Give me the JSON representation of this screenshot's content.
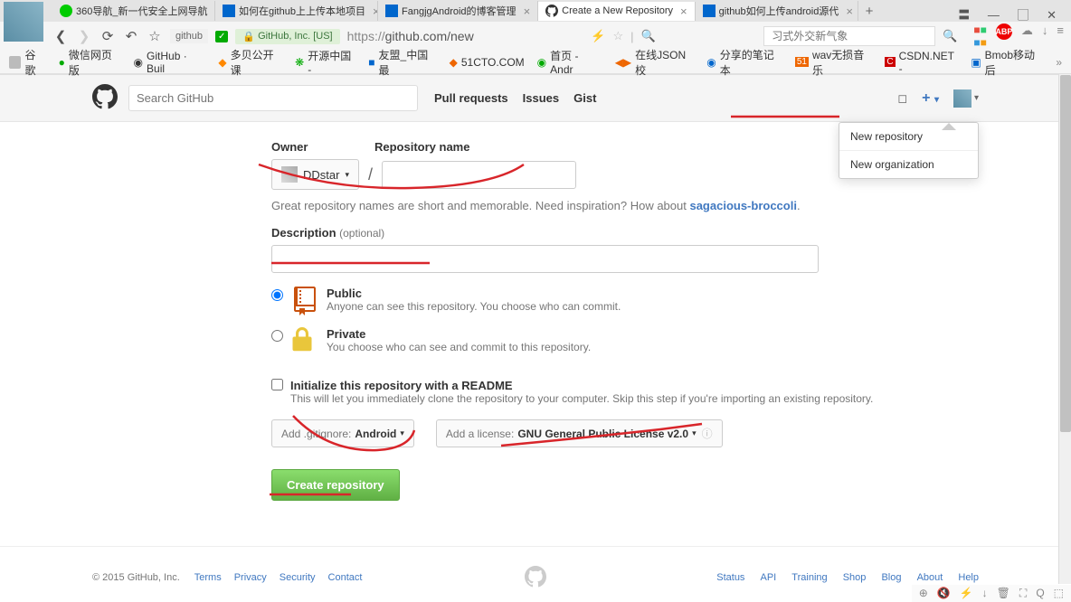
{
  "browser": {
    "tabs": [
      {
        "title": "360导航_新一代安全上网导航",
        "active": false
      },
      {
        "title": "如何在github上上传本地项目",
        "active": false
      },
      {
        "title": "FangjgAndroid的博客管理",
        "active": false
      },
      {
        "title": "Create a New Repository",
        "active": true
      },
      {
        "title": "github如何上传android源代",
        "active": false
      }
    ],
    "nav": {
      "site_label": "github",
      "company": "GitHub, Inc. [US]",
      "url_proto": "https://",
      "url_rest": "github.com/new",
      "search_placeholder": "习式外交新气象"
    },
    "bookmarks": [
      "谷歌",
      "微信网页版",
      "GitHub · Buil",
      "多贝公开课",
      "开源中国 -",
      "友盟_中国最",
      "51CTO.COM",
      "首页 - Andr",
      "在线JSON校",
      "分享的笔记本",
      "wav无损音乐",
      "CSDN.NET -",
      "Bmob移动后"
    ]
  },
  "github": {
    "search_placeholder": "Search GitHub",
    "nav_items": [
      "Pull requests",
      "Issues",
      "Gist"
    ],
    "dropdown": {
      "item1": "New repository",
      "item2": "New organization"
    }
  },
  "form": {
    "owner_label": "Owner",
    "repo_name_label": "Repository name",
    "owner_value": "DDstar",
    "hint_pre": "Great repository names are short and memorable. Need inspiration? How about ",
    "hint_suggestion": "sagacious-broccoli",
    "desc_label": "Description",
    "desc_optional": "(optional)",
    "public_title": "Public",
    "public_sub": "Anyone can see this repository. You choose who can commit.",
    "private_title": "Private",
    "private_sub": "You choose who can see and commit to this repository.",
    "readme_title": "Initialize this repository with a README",
    "readme_sub": "This will let you immediately clone the repository to your computer. Skip this step if you're importing an existing repository.",
    "gitignore_label": "Add .gitignore:",
    "gitignore_value": "Android",
    "license_label": "Add a license:",
    "license_value": "GNU General Public License v2.0",
    "create_button": "Create repository"
  },
  "footer": {
    "copyright": "© 2015 GitHub, Inc.",
    "left_links": [
      "Terms",
      "Privacy",
      "Security",
      "Contact"
    ],
    "right_links": [
      "Status",
      "API",
      "Training",
      "Shop",
      "Blog",
      "About",
      "Help"
    ]
  }
}
